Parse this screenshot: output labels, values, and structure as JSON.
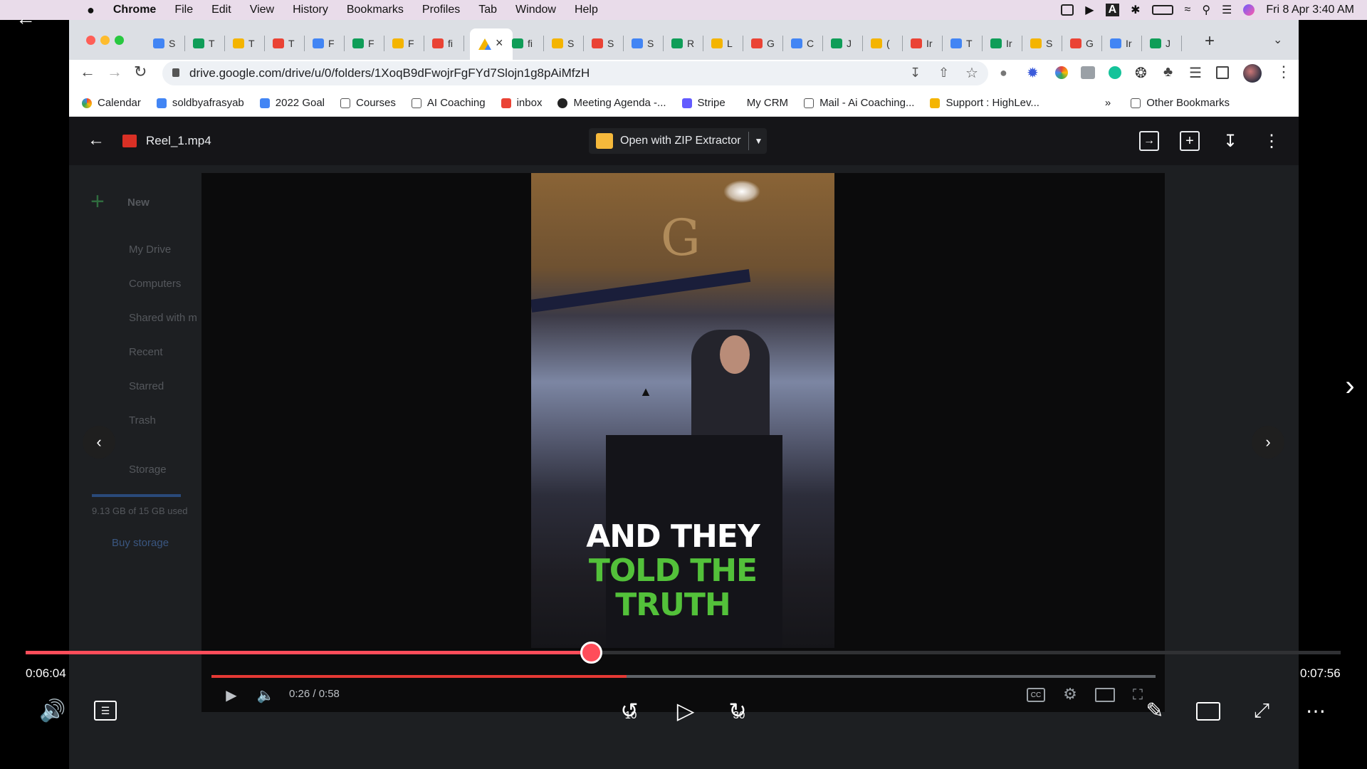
{
  "menubar": {
    "apple": "",
    "items": [
      "Chrome",
      "File",
      "Edit",
      "View",
      "History",
      "Bookmarks",
      "Profiles",
      "Tab",
      "Window",
      "Help"
    ],
    "clock": "Fri 8 Apr  3:40 AM"
  },
  "tabs": [
    "S",
    "T",
    "T",
    "T",
    "F",
    "F",
    "F",
    "fi",
    "",
    "fi",
    "S",
    "S",
    "S",
    "R",
    "L",
    "G",
    "C",
    "J",
    "(",
    "Ir",
    "T",
    "Ir",
    "S",
    "G",
    "Ir",
    "J"
  ],
  "new_tab": "+",
  "address": {
    "url": "drive.google.com/drive/u/0/folders/1XoqB9dFwojrFgFYd7Slojn1g8pAiMfzH"
  },
  "bookmarks": [
    "Calendar",
    "soldbyafrasyab",
    "2022 Goal",
    "Courses",
    "AI Coaching",
    "inbox",
    "Meeting Agenda -...",
    "Stripe",
    "My CRM",
    "Mail - Ai Coaching...",
    "Support : HighLev..."
  ],
  "bookmarks_more": "»",
  "other_bookmarks": "Other Bookmarks",
  "drive_sidebar": {
    "new": "New",
    "items": [
      "My Drive",
      "Computers",
      "Shared with m",
      "Recent",
      "Starred",
      "Trash",
      "Storage"
    ],
    "storage_used": "9.13 GB of 15 GB used",
    "buy_storage": "Buy storage"
  },
  "viewer": {
    "filename": "Reel_1.mp4",
    "open_with": "Open with ZIP Extractor"
  },
  "video": {
    "caption_line1": "AND THEY",
    "caption_line2": "TOLD THE",
    "caption_line3": "TRUTH",
    "logo_mark": "G"
  },
  "inner_player": {
    "time": "0:26 / 0:58",
    "progress": 0.44
  },
  "outer_player": {
    "elapsed": "0:06:04",
    "total": "0:07:56",
    "progress": 0.43,
    "skip_back": "10",
    "skip_fwd": "30"
  },
  "colors": {
    "accent": "#ff4d5a",
    "caption_green": "#53c13a"
  }
}
